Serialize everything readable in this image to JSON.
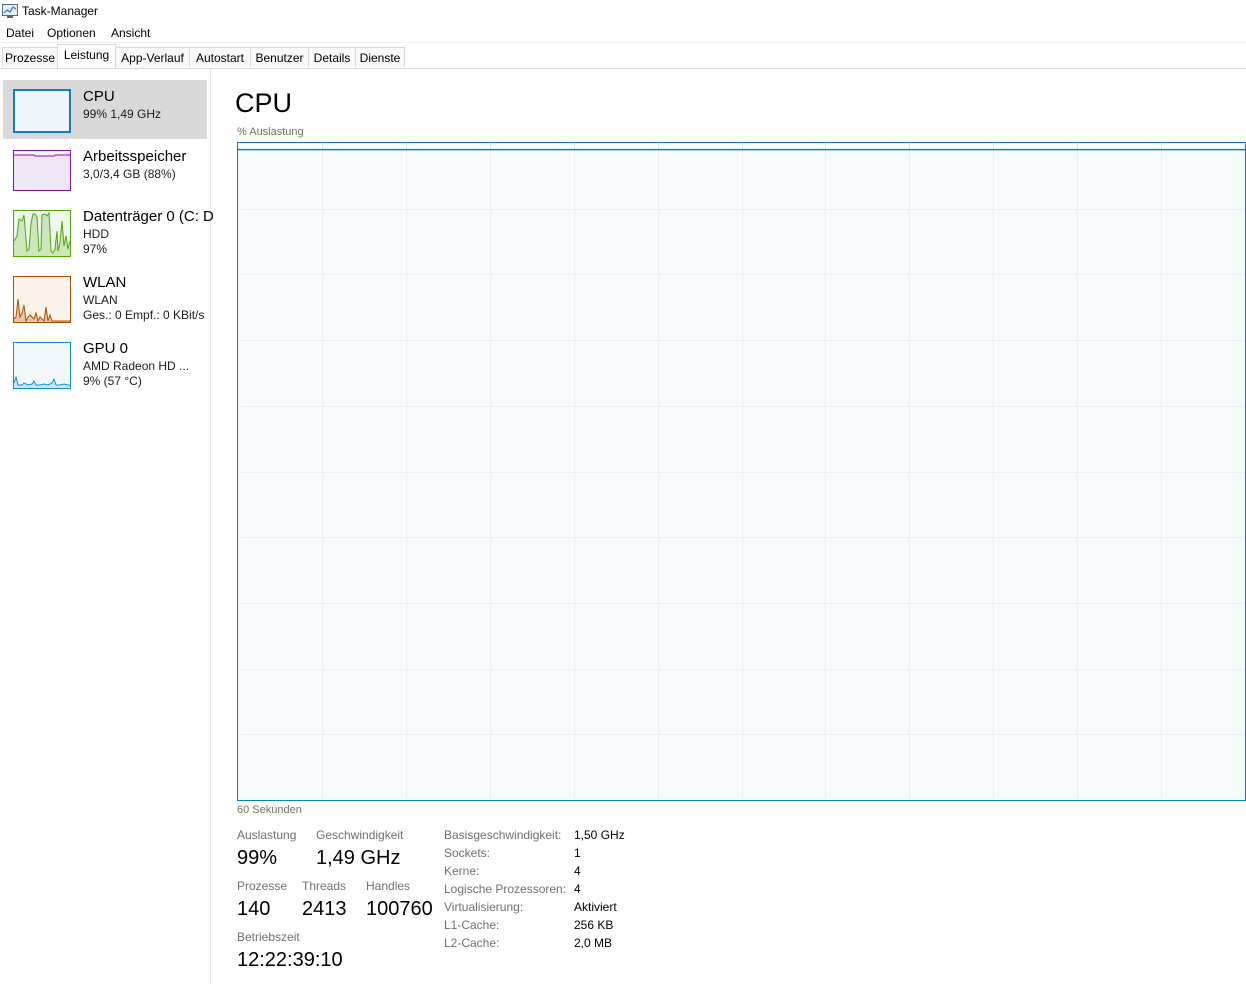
{
  "window": {
    "title": "Task-Manager",
    "icon": "task-manager-icon"
  },
  "menu": [
    "Datei",
    "Optionen",
    "Ansicht"
  ],
  "tabs": [
    {
      "label": "Prozesse",
      "active": false
    },
    {
      "label": "Leistung",
      "active": true
    },
    {
      "label": "App-Verlauf",
      "active": false
    },
    {
      "label": "Autostart",
      "active": false
    },
    {
      "label": "Benutzer",
      "active": false
    },
    {
      "label": "Details",
      "active": false
    },
    {
      "label": "Dienste",
      "active": false
    }
  ],
  "sidebar": {
    "items": [
      {
        "title": "CPU",
        "line1": "99%  1,49 GHz",
        "line2": "",
        "selected": true,
        "color": "#117dbb",
        "fill": "#f1f6fa"
      },
      {
        "title": "Arbeitsspeicher",
        "line1": "3,0/3,4 GB (88%)",
        "line2": "",
        "selected": false,
        "color": "#8b12ae",
        "fill": "#f4f2f4"
      },
      {
        "title": "Datenträger 0 (C: D",
        "line1": "HDD",
        "line2": "97%",
        "selected": false,
        "color": "#4da60c",
        "fill": "#eff7ea"
      },
      {
        "title": "WLAN",
        "line1": "WLAN",
        "line2": "Ges.: 0  Empf.: 0 KBit/s",
        "selected": false,
        "color": "#a74f01",
        "fill": "#fcf3eb"
      },
      {
        "title": "GPU 0",
        "line1": "AMD Radeon HD ...",
        "line2": "9%  (57 °C)",
        "selected": false,
        "color": "#1190d0",
        "fill": "#f1f7fb"
      }
    ]
  },
  "main": {
    "title": "CPU",
    "graph_label": "% Auslastung",
    "graph_footer": "60 Sekunden",
    "graph_color": "#117dbb",
    "graph_fill": "#f1f6fa",
    "grid_color": "#d9eaf4",
    "utilization_level": 0.99,
    "stats": {
      "auslastung": {
        "label": "Auslastung",
        "value": "99%"
      },
      "geschwindigkeit": {
        "label": "Geschwindigkeit",
        "value": "1,49 GHz"
      },
      "prozesse": {
        "label": "Prozesse",
        "value": "140"
      },
      "threads": {
        "label": "Threads",
        "value": "2413"
      },
      "handles": {
        "label": "Handles",
        "value": "100760"
      },
      "betriebszeit": {
        "label": "Betriebszeit",
        "value": "12:22:39:10"
      }
    },
    "details": [
      {
        "label": "Basisgeschwindigkeit:",
        "value": "1,50 GHz"
      },
      {
        "label": "Sockets:",
        "value": "1"
      },
      {
        "label": "Kerne:",
        "value": "4"
      },
      {
        "label": "Logische Prozessoren:",
        "value": "4"
      },
      {
        "label": "Virtualisierung:",
        "value": "Aktiviert"
      },
      {
        "label": "L1-Cache:",
        "value": "256 KB"
      },
      {
        "label": "L2-Cache:",
        "value": "2,0 MB"
      }
    ]
  }
}
